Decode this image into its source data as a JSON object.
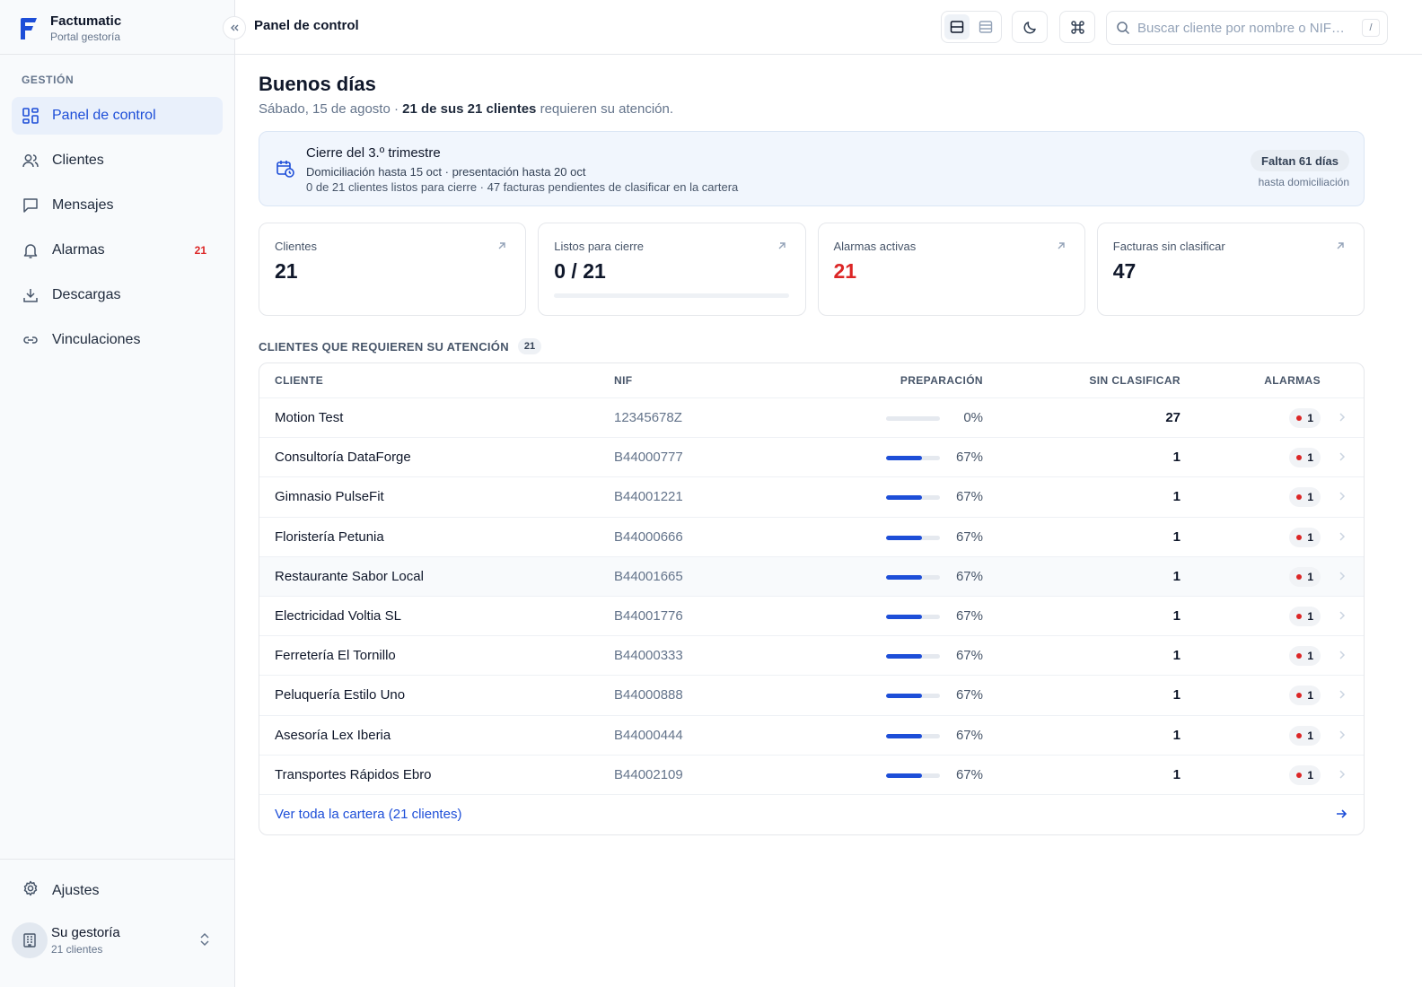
{
  "brand": {
    "name": "Factumatic",
    "subtitle": "Portal gestoría"
  },
  "sidebar": {
    "section_label": "GESTIÓN",
    "items": [
      {
        "label": "Panel de control",
        "icon": "dashboard-icon",
        "active": true
      },
      {
        "label": "Clientes",
        "icon": "users-icon"
      },
      {
        "label": "Mensajes",
        "icon": "message-icon"
      },
      {
        "label": "Alarmas",
        "icon": "bell-icon",
        "badge": "21"
      },
      {
        "label": "Descargas",
        "icon": "download-icon"
      },
      {
        "label": "Vinculaciones",
        "icon": "link-icon"
      }
    ],
    "settings_label": "Ajustes",
    "org": {
      "name": "Su gestoría",
      "subtitle": "21 clientes"
    }
  },
  "header": {
    "title": "Panel de control",
    "search_placeholder": "Buscar cliente por nombre o NIF…",
    "search_shortcut": "/"
  },
  "main": {
    "greeting": "Buenos días",
    "date": "Sábado, 15 de agosto",
    "separator": " · ",
    "attention_count": "21 de sus 21 clientes",
    "attention_suffix": " requieren su atención."
  },
  "banner": {
    "title": "Cierre del 3.º trimestre",
    "line1": "Domiciliación hasta 15 oct · presentación hasta 20 oct",
    "line2": "0 de 21 clientes listos para cierre · 47 facturas pendientes de clasificar en la cartera",
    "pill": "Faltan 61 días",
    "pill_sub": "hasta domiciliación"
  },
  "stats": [
    {
      "label": "Clientes",
      "value": "21"
    },
    {
      "label": "Listos para cierre",
      "value": "0 / 21",
      "progress": 0
    },
    {
      "label": "Alarmas activas",
      "value": "21",
      "danger": true
    },
    {
      "label": "Facturas sin clasificar",
      "value": "47"
    }
  ],
  "attention": {
    "title": "CLIENTES QUE REQUIEREN SU ATENCIÓN",
    "count": "21",
    "columns": [
      "CLIENTE",
      "NIF",
      "PREPARACIÓN",
      "SIN CLASIFICAR",
      "ALARMAS"
    ],
    "rows": [
      {
        "name": "Motion Test",
        "nif": "12345678Z",
        "prep": 0,
        "prep_label": "0%",
        "unclassified": "27",
        "alarms": "1"
      },
      {
        "name": "Consultoría DataForge",
        "nif": "B44000777",
        "prep": 67,
        "prep_label": "67%",
        "unclassified": "1",
        "alarms": "1"
      },
      {
        "name": "Gimnasio PulseFit",
        "nif": "B44001221",
        "prep": 67,
        "prep_label": "67%",
        "unclassified": "1",
        "alarms": "1"
      },
      {
        "name": "Floristería Petunia",
        "nif": "B44000666",
        "prep": 67,
        "prep_label": "67%",
        "unclassified": "1",
        "alarms": "1"
      },
      {
        "name": "Restaurante Sabor Local",
        "nif": "B44001665",
        "prep": 67,
        "prep_label": "67%",
        "unclassified": "1",
        "alarms": "1",
        "hover": true
      },
      {
        "name": "Electricidad Voltia SL",
        "nif": "B44001776",
        "prep": 67,
        "prep_label": "67%",
        "unclassified": "1",
        "alarms": "1"
      },
      {
        "name": "Ferretería El Tornillo",
        "nif": "B44000333",
        "prep": 67,
        "prep_label": "67%",
        "unclassified": "1",
        "alarms": "1"
      },
      {
        "name": "Peluquería Estilo Uno",
        "nif": "B44000888",
        "prep": 67,
        "prep_label": "67%",
        "unclassified": "1",
        "alarms": "1"
      },
      {
        "name": "Asesoría Lex Iberia",
        "nif": "B44000444",
        "prep": 67,
        "prep_label": "67%",
        "unclassified": "1",
        "alarms": "1"
      },
      {
        "name": "Transportes Rápidos Ebro",
        "nif": "B44002109",
        "prep": 67,
        "prep_label": "67%",
        "unclassified": "1",
        "alarms": "1"
      }
    ],
    "footer_link": "Ver toda la cartera (21 clientes)"
  },
  "colors": {
    "accent": "#1d4ed8",
    "danger": "#dc2626",
    "sidebar_bg": "#f8fafc",
    "banner_bg": "#f1f6fd"
  }
}
